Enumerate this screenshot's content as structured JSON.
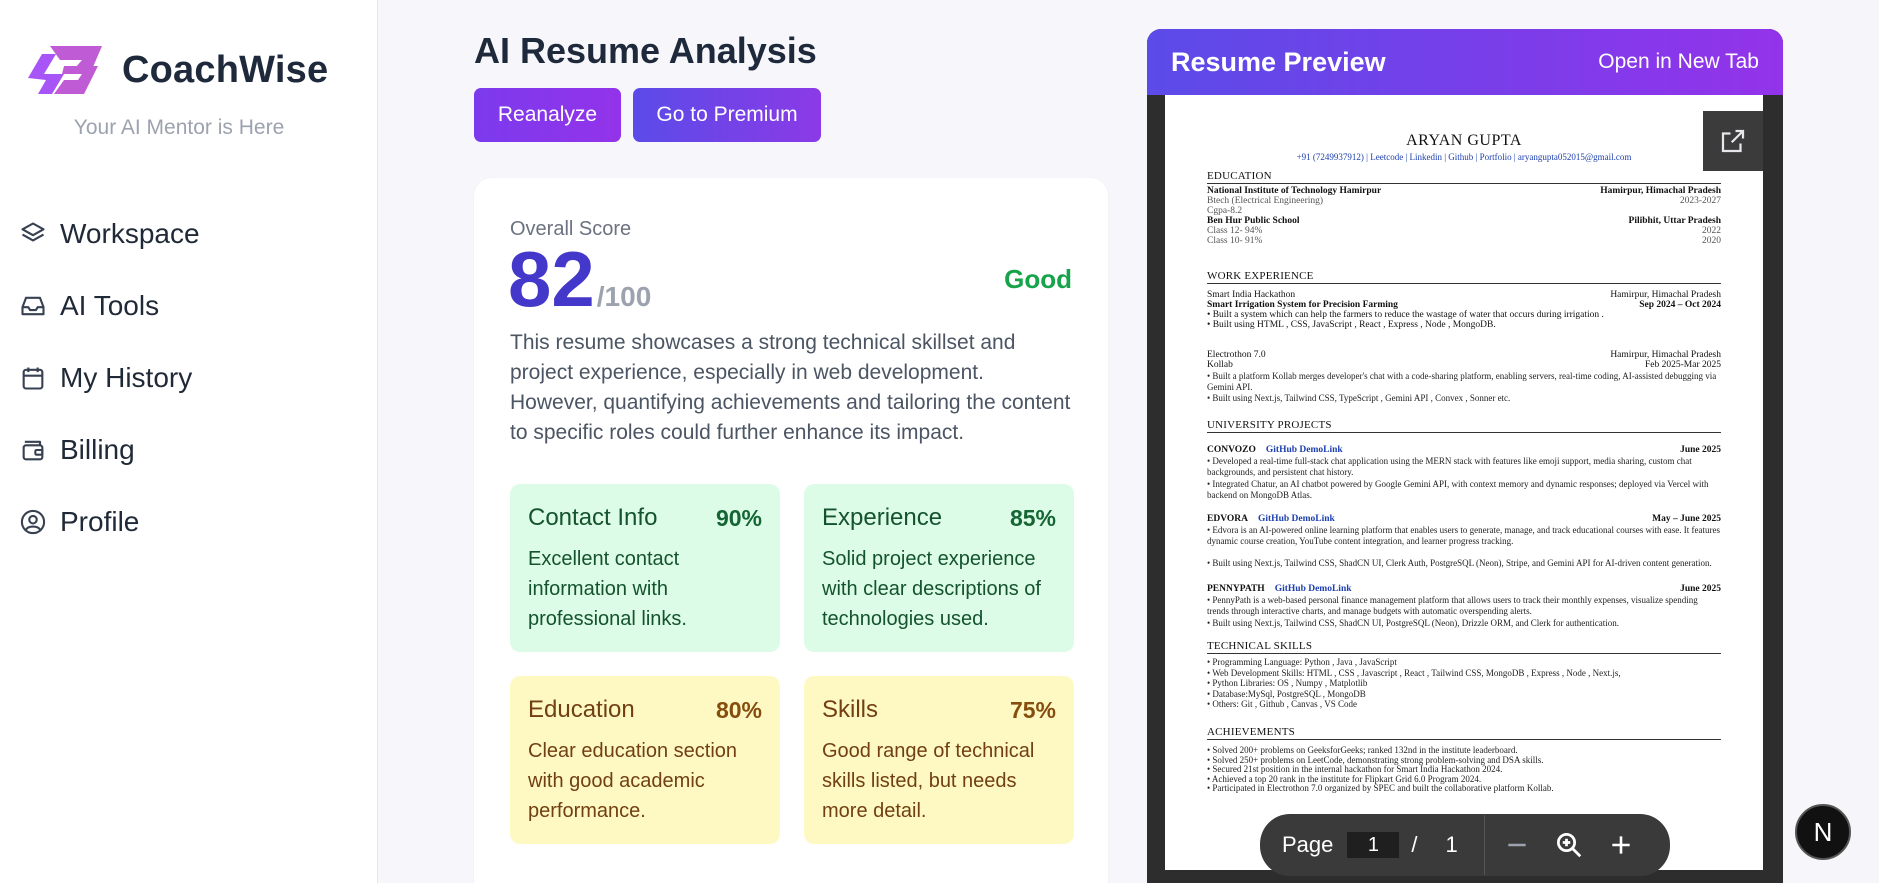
{
  "brand": {
    "name": "CoachWise",
    "tagline": "Your AI Mentor is Here",
    "logo_color": "#c05bd6"
  },
  "nav": [
    {
      "label": "Workspace",
      "icon": "layers-icon"
    },
    {
      "label": "AI Tools",
      "icon": "inbox-icon"
    },
    {
      "label": "My History",
      "icon": "calendar-icon"
    },
    {
      "label": "Billing",
      "icon": "wallet-icon"
    },
    {
      "label": "Profile",
      "icon": "user-circle-icon"
    }
  ],
  "page": {
    "title": "AI Resume Analysis",
    "reanalyze_label": "Reanalyze",
    "premium_label": "Go to Premium"
  },
  "score": {
    "label": "Overall Score",
    "value": "82",
    "max": "/100",
    "rating": "Good",
    "summary": "This resume showcases a strong technical skillset and project experience, especially in web development. However, quantifying achievements and tailoring the content to specific roles could further enhance its impact."
  },
  "tiles": [
    {
      "title": "Contact Info",
      "percent": "90%",
      "desc": "Excellent contact information with professional links."
    },
    {
      "title": "Experience",
      "percent": "85%",
      "desc": "Solid project experience with clear descriptions of technologies used."
    },
    {
      "title": "Education",
      "percent": "80%",
      "desc": "Clear education section with good academic performance."
    },
    {
      "title": "Skills",
      "percent": "75%",
      "desc": "Good range of technical skills listed, but needs more detail."
    }
  ],
  "preview": {
    "title": "Resume Preview",
    "open_label": "Open in New Tab",
    "page_label": "Page",
    "page_current": "1",
    "page_sep": "/",
    "page_total": "1"
  },
  "resume": {
    "name": "ARYAN GUPTA",
    "contact": "+91 (7249937912) | Leetcode | Linkedin | Github | Portfolio | aryangupta052015@gmail.com",
    "sec_education": "EDUCATION",
    "edu": [
      {
        "l": "National Institute of Technology Hamirpur",
        "r": "Hamirpur, Himachal Pradesh",
        "bold": true
      },
      {
        "l": "Btech (Electrical Engineering)",
        "r": "2023-2027",
        "gray": true
      },
      {
        "l": "Cgpa-8.2",
        "r": "",
        "gray": true
      },
      {
        "l": "Ben Hur Public School",
        "r": "Pilibhit, Uttar Pradesh",
        "bold": true
      },
      {
        "l": "Class 12- 94%",
        "r": "2022",
        "gray": true
      },
      {
        "l": "Class 10- 91%",
        "r": "2020",
        "gray": true
      }
    ],
    "sec_work": "WORK EXPERIENCE",
    "work1": [
      {
        "l": "Smart India Hackathon",
        "r": "Hamirpur, Himachal Pradesh"
      },
      {
        "l": "Smart Irrigation System for Precision Farming",
        "r": "Sep 2024 – Oct 2024",
        "bold": true
      },
      {
        "l": "•  Built a system which can help the farmers to reduce the wastage of water that occurs during irrigation .",
        "r": ""
      },
      {
        "l": "•  Built using HTML , CSS, JavaScript , React , Express , Node , MongoDB.",
        "r": ""
      }
    ],
    "work2": [
      {
        "l": "Electrothon 7.0",
        "r": "Hamirpur, Himachal Pradesh"
      },
      {
        "l": "Kollab",
        "r": "Feb 2025-Mar 2025"
      }
    ],
    "work2_bullets": "•  Built a platform Kollab merges developer's chat with a code-sharing platform, enabling servers, real-time coding, AI-assisted debugging via Gemini API.",
    "work2_bullets2": "•  Built using Next.js, Tailwind CSS, TypeScript , Gemini API , Convex , Sonner etc.",
    "sec_projects": "UNIVERSITY PROJECTS",
    "p1_name": "CONVOZO",
    "p1_link": "GitHub DemoLink",
    "p1_date": "June 2025",
    "p1_text": "• Developed a real-time full-stack chat application using the MERN stack with features like emoji support, media sharing, custom chat backgrounds, and persistent chat history.",
    "p1_text2": "• Integrated Chatur, an AI chatbot powered by Google Gemini API, with context memory and dynamic responses; deployed via Vercel with backend on MongoDB Atlas.",
    "p2_name": "EDVORA",
    "p2_link": "GitHub DemoLink",
    "p2_date": "May – June 2025",
    "p2_text": "• Edvora is an AI-powered online learning platform that enables users to generate, manage, and track educational courses with ease. It features dynamic course creation, YouTube content integration, and learner progress tracking.",
    "p2_text2": "• Built using Next.js, Tailwind CSS, ShadCN UI, Clerk Auth, PostgreSQL (Neon), Stripe, and Gemini API for AI-driven content generation.",
    "p3_name": "PENNYPATH",
    "p3_link": "GitHub DemoLink",
    "p3_date": "June 2025",
    "p3_text": "• PennyPath is a web-based personal finance management platform that allows users to track their monthly expenses, visualize spending trends through interactive charts, and manage budgets with automatic overspending alerts.",
    "p3_text2": "• Built using Next.js, Tailwind CSS, ShadCN UI, PostgreSQL (Neon), Drizzle ORM, and Clerk for authentication.",
    "sec_skills": "TECHNICAL SKILLS",
    "skills": [
      "•  Programming Language: Python , Java , JavaScript",
      "•  Web Development Skills: HTML , CSS , Javascript , React , Tailwind CSS, MongoDB , Express  , Node , Next.js,",
      "•  Python Libraries: OS , Numpy  , Matplotlib",
      "•  Database:MySql, PostgreSQL , MongoDB",
      "•  Others: Git , Github , Canvas , VS Code"
    ],
    "sec_achievements": "ACHIEVEMENTS",
    "achievements": [
      "• Solved 200+ problems on GeeksforGeeks; ranked 132nd in the institute leaderboard.",
      "• Solved 250+ problems on LeetCode, demonstrating strong problem-solving and DSA skills.",
      "• Secured 21st position in the internal hackathon for Smart India Hackathon 2024.",
      "• Achieved a top 20 rank in the institute for Flipkart Grid 6.0 Program 2024.",
      "• Participated in Electrothon 7.0 organized by SPEC and built the collaborative platform Kollab."
    ]
  },
  "badge": {
    "letter": "N"
  },
  "colors": {
    "accent": "#7c3aed",
    "score": "#4338ca",
    "good": "#16a34a",
    "green_tile": "#dcfce7",
    "yellow_tile": "#fef9c3"
  }
}
